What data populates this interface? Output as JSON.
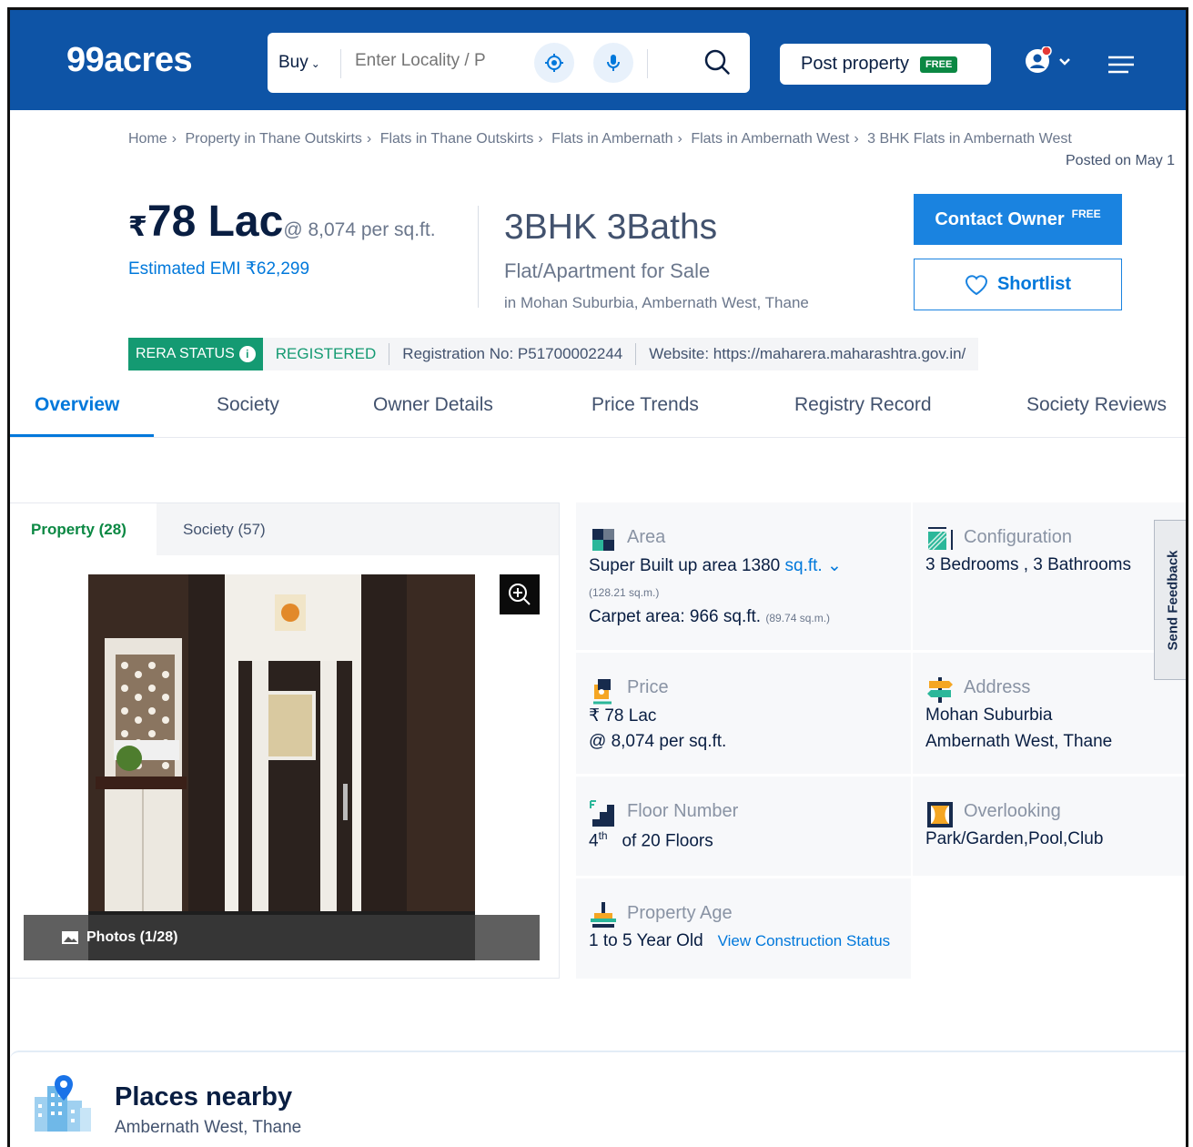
{
  "header": {
    "logo": "99acres",
    "buy_label": "Buy",
    "search_placeholder": "Enter Locality / P",
    "post_property_label": "Post property",
    "free_badge": "FREE"
  },
  "breadcrumb": [
    "Home",
    "Property in Thane Outskirts",
    "Flats in Thane Outskirts",
    "Flats in Ambernath",
    "Flats in Ambernath West",
    "3 BHK Flats in Ambernath West"
  ],
  "posted_on": "Posted on May 1",
  "listing": {
    "currency_symbol": "₹",
    "price": "78 Lac",
    "price_per_sqft": "@ 8,074 per sq.ft.",
    "emi": "Estimated EMI ₹62,299",
    "title": "3BHK 3Baths",
    "type": "Flat/Apartment for Sale",
    "location": "in Mohan Suburbia, Ambernath West, Thane",
    "contact_label": "Contact Owner",
    "contact_free": "FREE",
    "shortlist_label": "Shortlist"
  },
  "rera": {
    "status_label": "RERA STATUS",
    "info_glyph": "i",
    "status_value": "REGISTERED",
    "registration": "Registration No: P51700002244",
    "website": "Website: https://maharera.maharashtra.gov.in/"
  },
  "tabs": [
    "Overview",
    "Society",
    "Owner Details",
    "Price Trends",
    "Registry Record",
    "Society Reviews"
  ],
  "gallery": {
    "tab_property": "Property (28)",
    "tab_society": "Society (57)",
    "photos_label": "Photos (1/28)"
  },
  "details": {
    "area": {
      "label": "Area",
      "super_built": "Super Built up area 1380",
      "unit": "sq.ft.",
      "super_built_sqm": "(128.21 sq.m.)",
      "carpet": "Carpet area: 966 sq.ft.",
      "carpet_sqm": "(89.74 sq.m.)"
    },
    "configuration": {
      "label": "Configuration",
      "value": "3 Bedrooms , 3 Bathrooms"
    },
    "price": {
      "label": "Price",
      "value": "₹ 78 Lac",
      "per_sqft": "@ 8,074 per sq.ft."
    },
    "address": {
      "label": "Address",
      "line1": "Mohan Suburbia",
      "line2": "Ambernath West, Thane"
    },
    "floor": {
      "label": "Floor Number",
      "number": "4",
      "suffix": "th",
      "of_floors": "of 20 Floors"
    },
    "overlooking": {
      "label": "Overlooking",
      "value": "Park/Garden,Pool,Club"
    },
    "age": {
      "label": "Property Age",
      "value": "1 to 5 Year Old",
      "link": "View Construction Status"
    }
  },
  "feedback_label": "Send Feedback",
  "places": {
    "title": "Places nearby",
    "subtitle": "Ambernath West, Thane"
  },
  "colors": {
    "header_bg": "#0e54a6",
    "accent_blue": "#0078db",
    "rera_green": "#149a72",
    "free_green": "#0b8843"
  }
}
